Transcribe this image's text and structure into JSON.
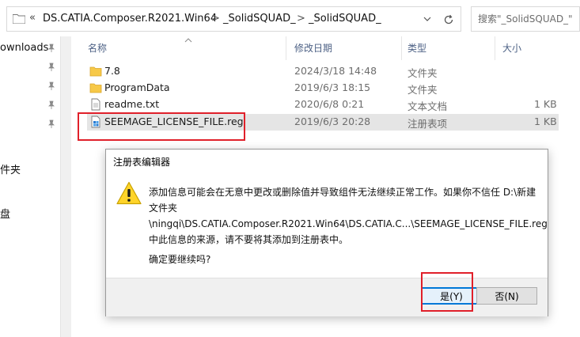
{
  "address": {
    "chevron": "«",
    "crumbs": [
      "DS.CATIA.Composer.R2021.Win64",
      "_SolidSQUAD_",
      "_SolidSQUAD_"
    ],
    "separator": ">",
    "search_placeholder": "搜索\"_SolidSQUAD_\""
  },
  "nav": {
    "items": [
      "ownloads",
      "件夹",
      "盘"
    ]
  },
  "columns": {
    "name": "名称",
    "date": "修改日期",
    "type": "类型",
    "size": "大小"
  },
  "files": [
    {
      "name": "7.8",
      "date": "2024/3/18 14:48",
      "type": "文件夹",
      "size": "",
      "icon": "folder-icon"
    },
    {
      "name": "ProgramData",
      "date": "2019/6/3 18:15",
      "type": "文件夹",
      "size": "",
      "icon": "folder-icon"
    },
    {
      "name": "readme.txt",
      "date": "2020/6/8 0:21",
      "type": "文本文档",
      "size": "1 KB",
      "icon": "text-file-icon"
    },
    {
      "name": "SEEMAGE_LICENSE_FILE.reg",
      "date": "2019/6/3 20:28",
      "type": "注册表项",
      "size": "1 KB",
      "icon": "registry-file-icon"
    }
  ],
  "dialog": {
    "title": "注册表编辑器",
    "line1": "添加信息可能会在无意中更改或删除值并导致组件无法继续正常工作。如果你不信任 D:\\新建",
    "line2": "文件夹",
    "line3": "\\ningqi\\DS.CATIA.Composer.R2021.Win64\\DS.CATIA.C...\\SEEMAGE_LICENSE_FILE.reg",
    "line4": "中此信息的来源，请不要将其添加到注册表中。",
    "confirm": "确定要继续吗?",
    "yes_label": "是(Y)",
    "no_label": "否(N)"
  },
  "colors": {
    "highlight": "#e0202a",
    "folder": "#f7c948",
    "accent": "#0078d7"
  }
}
